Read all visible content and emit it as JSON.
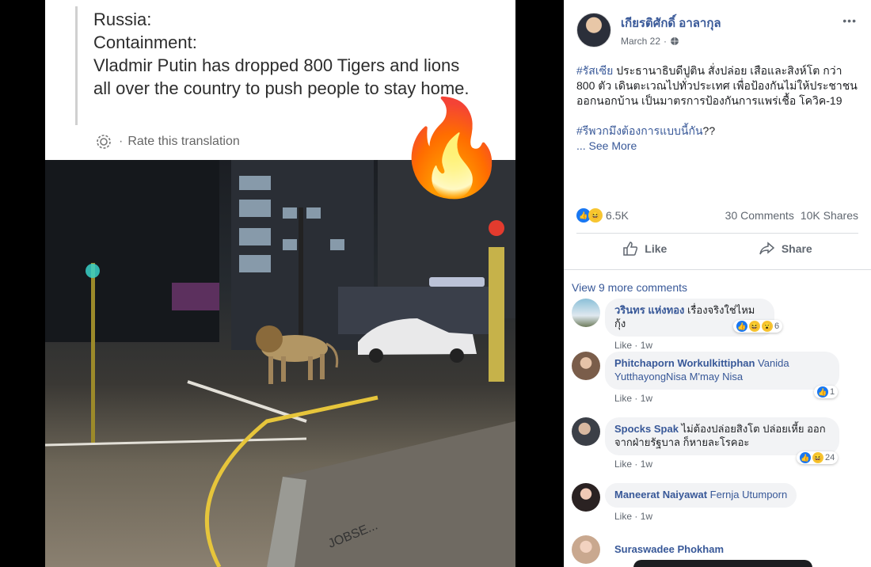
{
  "left": {
    "translation_lines": [
      "Russia:",
      "Containment:",
      "Vladmir Putin has dropped 800 Tigers and lions all over the country to push people to stay home."
    ],
    "rate_label": "Rate this translation",
    "fire_emoji": "🔥",
    "photo_sign": "JOBSE..."
  },
  "post": {
    "author": "เกียรติศักดิ์ อาลากุล",
    "date": "March 22",
    "privacy_icon": "globe-icon",
    "more_icon": "•••",
    "hashtag1": "#รัสเซีย",
    "text1": " ประธานาธิบดีปูติน สั่งปล่อย เสือและสิงห์โต กว่า 800 ตัว เดินตะเวณไปทั่วประเทศ เพื่อป้องกันไม่ให้ประชาชนออกนอกบ้าน เป็นมาตรการป้องกันการแพร่เชื้อ โควิค-19",
    "hashtag2": "#รีพวกมึงต้องการแบบนี้กัน",
    "text2": "??",
    "see_more": "... See More",
    "reaction_count": "6.5K",
    "comments_count": "30 Comments",
    "shares_count": "10K Shares",
    "like_label": "Like",
    "share_label": "Share",
    "view_more": "View 9 more comments"
  },
  "comments": [
    {
      "name": "วรินทร แห่งทอง",
      "text": " เรื่องจริงใช่ไหมกุ้ง",
      "like": "Like",
      "time": "1w",
      "reactions": "6"
    },
    {
      "name": "Phitchaporn Workulkittiphan",
      "text": " Vanida YutthayongNisa M'may Nisa",
      "like": "Like",
      "time": "1w",
      "reactions": "1"
    },
    {
      "name": "Spocks Spak",
      "text": " ไม่ต้องปล่อยสิงโต ปล่อยเหี้ย ออกจากฝ่ายรัฐบาล ก็หายละโรคอะ",
      "like": "Like",
      "time": "1w",
      "reactions": "24"
    },
    {
      "name": "Maneerat Naiyawat",
      "text": " Fernja Utumporn",
      "like": "Like",
      "time": "1w"
    },
    {
      "name": "Suraswadee Phokham"
    }
  ]
}
